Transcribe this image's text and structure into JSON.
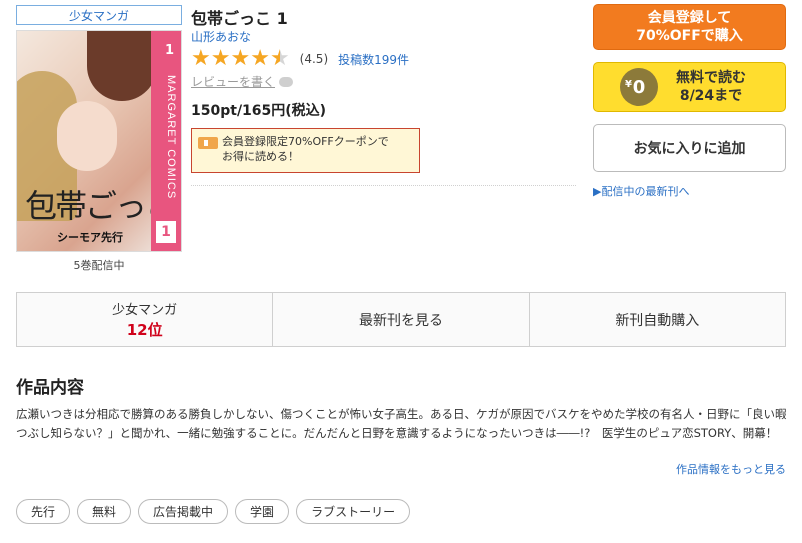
{
  "genre_badge": "少女マンガ",
  "book": {
    "title": "包帯ごっこ 1",
    "author": "山形あおな",
    "rating_value": 4.5,
    "rating_score": "(4.5)",
    "review_count": "投稿数199件",
    "write_review": "レビューを書く",
    "price": "150pt/165円(税込)",
    "coupon_line1": "会員登録限定70%OFFクーポンで",
    "coupon_line2": "お得に読める！",
    "volumes_note": "5巻配信中"
  },
  "cover": {
    "spine_text": "MARGARET COMICS",
    "spine_num": "1",
    "vol_num": "1",
    "title_art": "包帯ごっこ",
    "imprint": "シーモア先行"
  },
  "buttons": {
    "register_line1": "会員登録して",
    "register_line2": "70%OFFで購入",
    "free_coin": "0",
    "free_yen": "¥",
    "free_line1": "無料で読む",
    "free_line2": "8/24まで",
    "favorite": "お気に入りに追加"
  },
  "newest_link": "▶配信中の最新刊へ",
  "action_bar": {
    "rank_label": "少女マンガ",
    "rank_value": "12位",
    "latest": "最新刊を見る",
    "auto_buy": "新刊自動購入"
  },
  "section_title": "作品内容",
  "description": "広瀬いつきは分相応で勝算のある勝負しかしない、傷つくことが怖い女子高生。ある日、ケガが原因でバスケをやめた学校の有名人・日野に「良い暇つぶし知らない？」と聞かれ、一緒に勉強することに。だんだんと日野を意識するようになったいつきは――!?　医学生のピュア恋STORY、開幕！",
  "more_info": "作品情報をもっと見る",
  "tags": [
    "先行",
    "無料",
    "広告掲載中",
    "学園",
    "ラブストーリー"
  ],
  "colors": {
    "accent_orange": "#f27b1f",
    "accent_yellow": "#ffdd2e",
    "link_blue": "#2a6fc4",
    "rank_red": "#d0021b",
    "star": "#f5a623"
  }
}
